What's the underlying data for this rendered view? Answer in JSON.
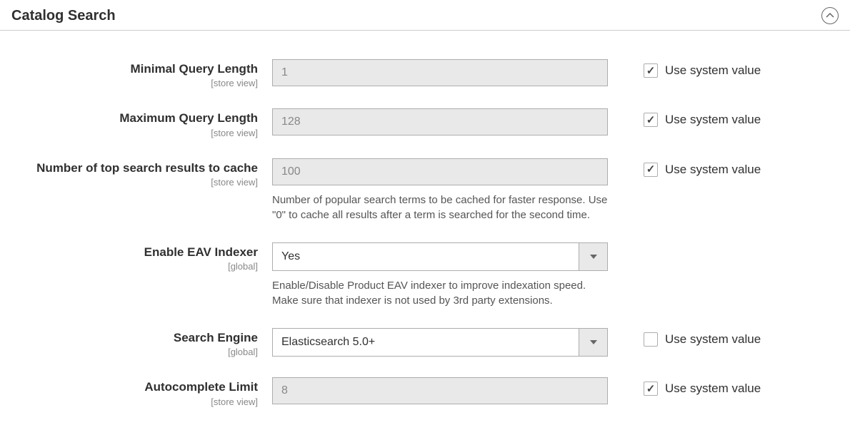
{
  "section": {
    "title": "Catalog Search"
  },
  "fields": {
    "min_query": {
      "label": "Minimal Query Length",
      "scope": "[store view]",
      "value": "1",
      "use_system_label": "Use system value"
    },
    "max_query": {
      "label": "Maximum Query Length",
      "scope": "[store view]",
      "value": "128",
      "use_system_label": "Use system value"
    },
    "top_cache": {
      "label": "Number of top search results to cache",
      "scope": "[store view]",
      "value": "100",
      "note": "Number of popular search terms to be cached for faster response. Use \"0\" to cache all results after a term is searched for the second time.",
      "use_system_label": "Use system value"
    },
    "eav": {
      "label": "Enable EAV Indexer",
      "scope": "[global]",
      "value": "Yes",
      "note": "Enable/Disable Product EAV indexer to improve indexation speed. Make sure that indexer is not used by 3rd party extensions."
    },
    "engine": {
      "label": "Search Engine",
      "scope": "[global]",
      "value": "Elasticsearch 5.0+",
      "use_system_label": "Use system value"
    },
    "autocomplete": {
      "label": "Autocomplete Limit",
      "scope": "[store view]",
      "value": "8",
      "use_system_label": "Use system value"
    }
  }
}
